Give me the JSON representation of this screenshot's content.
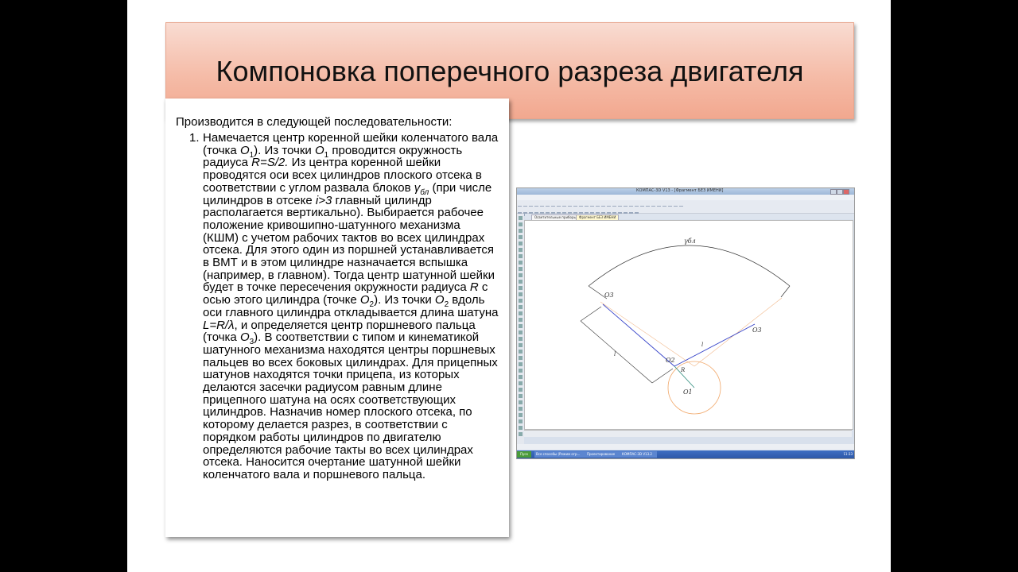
{
  "slide": {
    "title": "Компоновка поперечного разреза двигателя",
    "intro": "Производится в следующей последовательности:",
    "item_number": "1.",
    "item_html": "Намечается центр коренной шейки коленчатого вала (точка <i>О</i><sub>1</sub>). Из точки <i>О</i><sub>1</sub> проводится окружность радиуса <i>R=S/2.</i> Из центра коренной шейки проводятся оси всех цилиндров плоского отсека в соответствии с углом развала блоков <i>γ</i><sub><i>бл</i></sub> (при числе цилиндров в отсеке <i>i&gt;3</i> главный цилиндр располагается вертикально). Выбирается рабочее положение кривошипно-шатунного механизма (КШМ) с учетом рабочих тактов во всех цилиндрах отсека. Для этого один из поршней устанавливается в ВМТ и в этом цилиндре назначается вспышка (например, в главном). Тогда центр шатунной шейки будет в точке пересечения окружности радиуса <i>R</i> с осью этого цилиндра (точке <i>О</i><sub>2</sub>). Из точки <i>О</i><sub>2</sub> вдоль оси главного цилиндра откладывается длина шатуна <i>L=R/λ</i>, и определяется центр поршневого пальца (точка <i>О</i><sub>3</sub>). В соответствии с типом и кинематикой шатунного механизма находятся центры поршневых пальцев во всех боковых цилиндрах. Для прицепных шатунов находятся точки прицепа, из которых делаются засечки радиусом равным длине прицепного шатуна на осях соответствующих цилиндров. Назначив номер плоского отсека, по которому делается разрез, в соответствии с порядком работы цилиндров по двигателю определяются рабочие такты во всех цилиндрах отсека. Наносится очертание шатунной шейки коленчатого вала и поршневого пальца."
  },
  "screenshot": {
    "window_title": "КОМПАС-3D V13 - [Фрагмент БЕЗ ИМЕНИ]",
    "menu": [
      "Файл",
      "Редактор",
      "Выделить",
      "Вид",
      "Вставка",
      "Инструменты",
      "Спецификация",
      "Сервис",
      "Окно",
      "Справка",
      "Библиотеки"
    ],
    "tabs": [
      "Осветительные приборы",
      "Фрагмент БЕЗ ИМЕНИ"
    ],
    "status_text": "Щелкните левой кнопкой мыши на объекте для его выделения (вместе с Ctrl или Shift - добавить к выделенным)",
    "taskbar": {
      "start": "Пуск",
      "items": [
        "Все способы (Режим огр...",
        "Проектирование ДВС",
        "КОМПАС-3D V13.2"
      ],
      "clock": "11:33"
    },
    "labels": {
      "gamma": "γбл",
      "o3_left": "O3",
      "o3_right": "O3",
      "o2": "O2",
      "o1": "O1",
      "r": "R",
      "l_left": "l",
      "l_right": "l"
    }
  }
}
